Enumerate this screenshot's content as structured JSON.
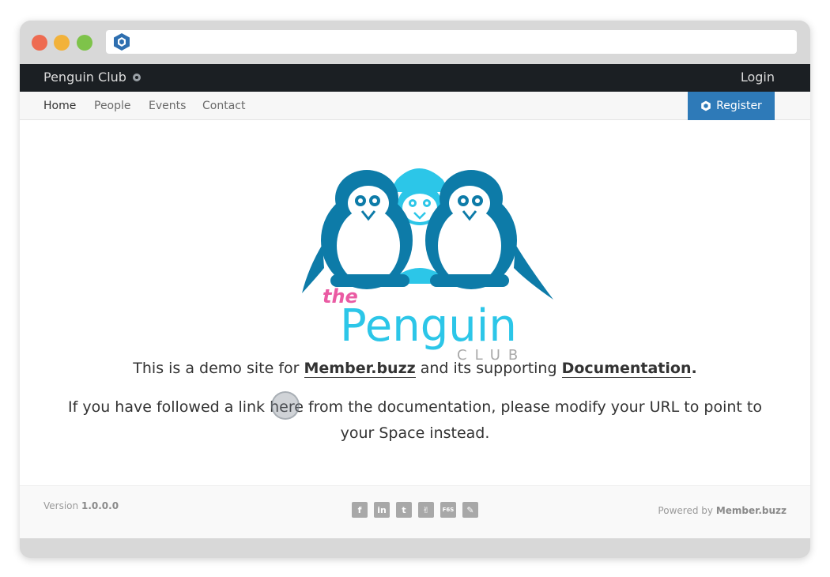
{
  "browser": {
    "traffic_lights": [
      "close",
      "minimize",
      "maximize"
    ],
    "url": ""
  },
  "topbar": {
    "brand": "Penguin Club",
    "login": "Login"
  },
  "nav": {
    "items": [
      {
        "label": "Home",
        "active": true
      },
      {
        "label": "People",
        "active": false
      },
      {
        "label": "Events",
        "active": false
      },
      {
        "label": "Contact",
        "active": false
      }
    ],
    "register_label": "Register"
  },
  "logo": {
    "the": "the",
    "penguin": "Penguin",
    "club": "CLUB"
  },
  "content": {
    "para1_prefix": "This is a demo site for ",
    "para1_link1": "Member.buzz",
    "para1_middle": " and its supporting ",
    "para1_link2": "Documentation",
    "para1_suffix": ".",
    "para2": "If you have followed a link here from the documentation, please modify your URL to point to your Space instead."
  },
  "footer": {
    "version_label": "Version",
    "version_value": "1.0.0.0",
    "social": [
      "facebook-icon",
      "linkedin-icon",
      "twitter-icon",
      "vine-icon",
      "f6s-icon",
      "feather-icon"
    ],
    "social_glyphs": [
      "f",
      "in",
      "t",
      "✌",
      "F6S",
      "✎"
    ],
    "powered_label": "Powered by",
    "powered_value": "Member.buzz"
  },
  "colors": {
    "topbar": "#1b1f23",
    "register": "#2e7ab8",
    "penguin_dark": "#0d7ba8",
    "penguin_light": "#2cc6e8",
    "the_pink": "#ea5ba3"
  }
}
